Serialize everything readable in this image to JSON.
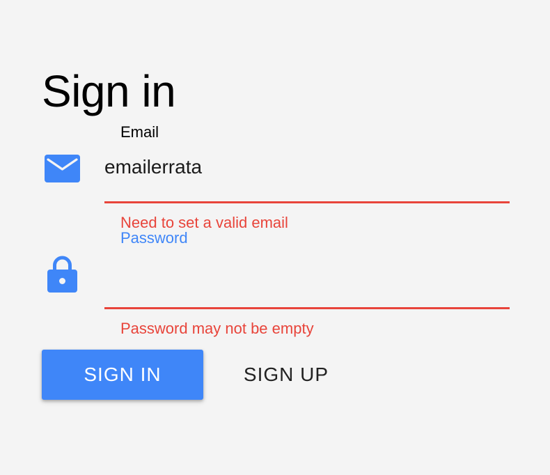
{
  "form": {
    "title": "Sign in",
    "email": {
      "label": "Email",
      "value": "emailerrata",
      "error": "Need to set a valid email",
      "icon": "mail-icon"
    },
    "password": {
      "label": "Password",
      "value": "",
      "error": "Password may not be empty",
      "icon": "lock-icon"
    },
    "buttons": {
      "sign_in": "SIGN IN",
      "sign_up": "SIGN UP"
    }
  },
  "colors": {
    "accent": "#3f86f8",
    "error": "#e8443a",
    "background": "#f4f4f4"
  }
}
